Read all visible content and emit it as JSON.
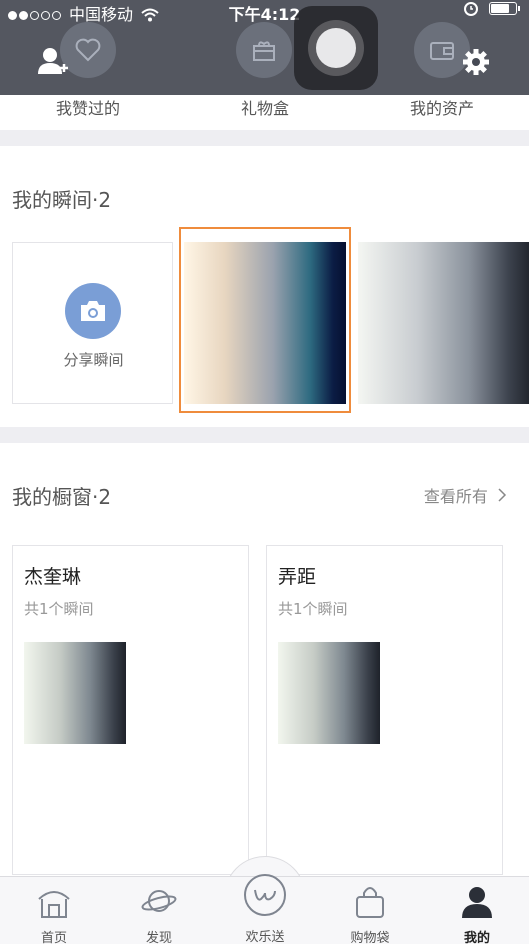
{
  "status_bar": {
    "carrier": "中国移动",
    "time": "下午4:12"
  },
  "header": {
    "shortcuts": [
      {
        "label": "我赞过的",
        "icon": "heart-icon"
      },
      {
        "label": "礼物盒",
        "icon": "gift-icon"
      },
      {
        "label": "我的资产",
        "icon": "wallet-icon"
      }
    ]
  },
  "moments": {
    "title": "我的瞬间·2",
    "share_label": "分享瞬间"
  },
  "showcase": {
    "title": "我的橱窗·2",
    "see_all": "查看所有",
    "cards": [
      {
        "name": "杰奎琳",
        "count": "共1个瞬间"
      },
      {
        "name": "弄距",
        "count": "共1个瞬间"
      }
    ]
  },
  "tabbar": {
    "tabs": [
      {
        "label": "首页",
        "icon": "home-icon"
      },
      {
        "label": "发现",
        "icon": "planet-icon"
      },
      {
        "label": "欢乐送",
        "icon": "w-logo-icon"
      },
      {
        "label": "购物袋",
        "icon": "bag-icon"
      },
      {
        "label": "我的",
        "icon": "person-icon",
        "active": true
      }
    ]
  },
  "colors": {
    "accent_frame": "#ef8c3c",
    "camera_circle": "#7a9ed6",
    "header_bg": "#464a54"
  }
}
